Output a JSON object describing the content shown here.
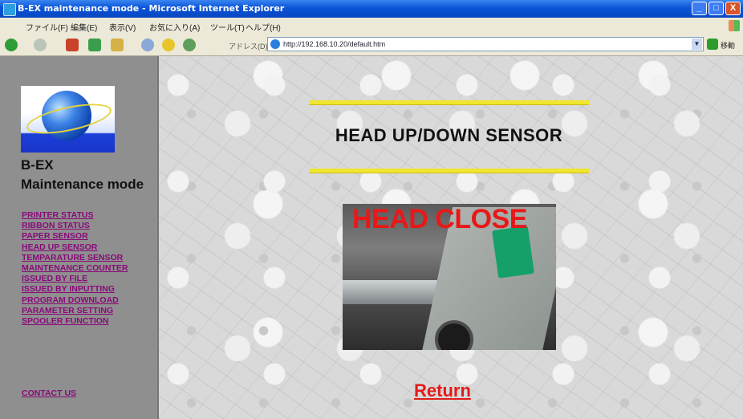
{
  "window": {
    "title": "B-EX maintenance mode - Microsoft Internet Explorer",
    "minimize": "_",
    "maximize": "□",
    "close": "X"
  },
  "menubar": {
    "items": [
      "ファイル(F)",
      "編集(E)",
      "表示(V)",
      "お気に入り(A)",
      "ツール(T)",
      "ヘルプ(H)"
    ]
  },
  "toolbar": {
    "address_label": "アドレス(D)",
    "url": "http://192.168.10.20/default.htm",
    "go_label": "移動",
    "icons": [
      "back-icon",
      "forward-icon",
      "stop-icon",
      "refresh-icon",
      "home-icon",
      "search-icon",
      "favorites-icon",
      "history-icon"
    ]
  },
  "sidebar": {
    "app_name": "B-EX",
    "subtitle": "Maintenance mode",
    "nav": [
      "PRINTER STATUS",
      "RIBBON STATUS",
      "PAPER SENSOR",
      "HEAD UP SENSOR",
      "TEMPARATURE SENSOR",
      "MAINTENANCE COUNTER",
      "ISSUED BY FILE",
      "ISSUED BY INPUTTING",
      "PROGRAM DOWNLOAD",
      "PARAMETER SETTING",
      "SPOOLER FUNCTION"
    ],
    "contact": "CONTACT US"
  },
  "main": {
    "title": "HEAD UP/DOWN SENSOR",
    "status_text": "HEAD CLOSE",
    "return_label": "Return"
  },
  "colors": {
    "link": "#8a0a7a",
    "accent_yellow": "#f0e62e",
    "status_red": "#e81818"
  }
}
